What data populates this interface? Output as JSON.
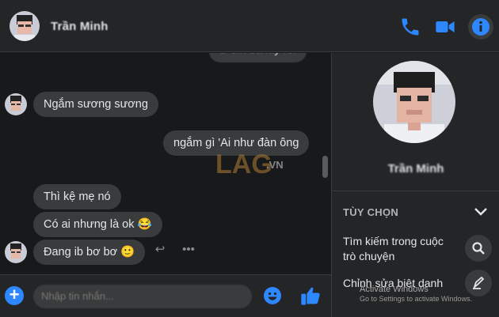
{
  "header": {
    "contact_name": "Trần Minh",
    "icons": [
      "phone-icon",
      "video-camera-icon",
      "info-icon"
    ]
  },
  "messages": [
    {
      "side": "right",
      "text": "ừ em ba lay roi"
    },
    {
      "side": "left",
      "text": "Ngắm sương sương"
    },
    {
      "side": "right",
      "text": "ngắm gì 'Ai như đàn ông"
    },
    {
      "side": "left",
      "text": "Thì kệ mẹ nó"
    },
    {
      "side": "left",
      "text": "Có ai nhưng là ok 😂"
    },
    {
      "side": "left",
      "text": "Đang ib bơ bơ 🙂"
    }
  ],
  "message_actions": [
    "react-icon",
    "reply-icon",
    "more-icon"
  ],
  "composer": {
    "placeholder": "Nhập tin nhắn..."
  },
  "sidebar": {
    "profile_name": "Trần Minh",
    "section_title": "TÙY CHỌN",
    "items": [
      {
        "label": "Tìm kiếm trong cuộc trò chuyện",
        "icon": "search-icon"
      },
      {
        "label": "Chỉnh sửa biệt danh",
        "icon": "pencil-icon"
      }
    ],
    "windows_watermark": [
      "Activate Windows",
      "Go to Settings to activate Windows."
    ]
  },
  "logo_watermark": "LAG.VN",
  "colors": {
    "accent": "#2d88ff",
    "bubble": "#3a3b3c",
    "background": "#18191a",
    "panel": "#242526"
  }
}
